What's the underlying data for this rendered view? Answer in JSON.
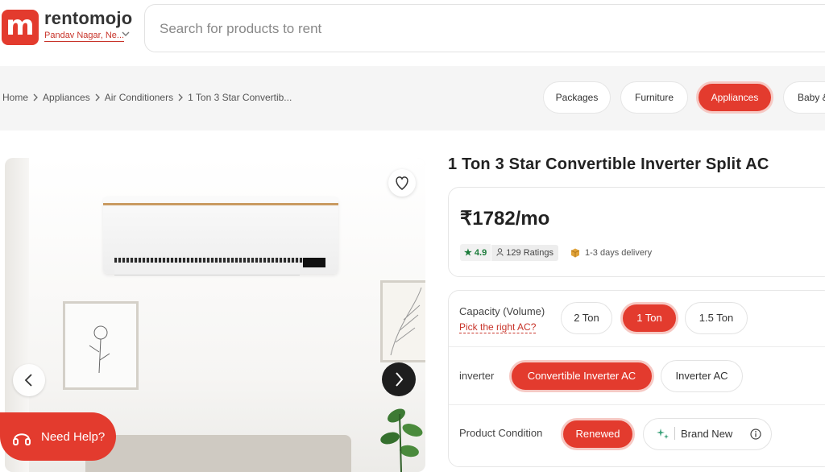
{
  "header": {
    "logo_letter": "m",
    "brand": "rentomojo",
    "location": "Pandav Nagar, Ne...",
    "search_placeholder": "Search for products to rent"
  },
  "breadcrumb": [
    "Home",
    "Appliances",
    "Air Conditioners",
    "1 Ton 3 Star Convertib..."
  ],
  "categories": [
    {
      "label": "Packages",
      "active": false
    },
    {
      "label": "Furniture",
      "active": false
    },
    {
      "label": "Appliances",
      "active": true
    },
    {
      "label": "Baby &",
      "active": false
    }
  ],
  "product": {
    "title": "1 Ton 3 Star Convertible Inverter Split AC",
    "price": "₹1782/mo",
    "rating": "4.9",
    "ratings_count": "129 Ratings",
    "delivery": "1-3 days delivery"
  },
  "options": {
    "capacity_label": "Capacity (Volume)",
    "capacity_help": "Pick the right AC?",
    "capacity": [
      "2 Ton",
      "1 Ton",
      "1.5 Ton"
    ],
    "capacity_selected": "1 Ton",
    "inverter_label": "inverter",
    "inverter": [
      "Convertible Inverter AC",
      "Inverter AC"
    ],
    "inverter_selected": "Convertible Inverter AC",
    "condition_label": "Product Condition",
    "condition": [
      "Renewed",
      "Brand New"
    ],
    "condition_selected": "Renewed"
  },
  "help": {
    "label": "Need Help?"
  },
  "colors": {
    "accent": "#e33b2e",
    "accent_light": "#f6c9c4"
  },
  "icons": [
    "chevron-down-icon",
    "chevron-right-icon",
    "heart-icon",
    "arrow-left-icon",
    "arrow-right-icon",
    "star-icon",
    "user-icon",
    "box-icon",
    "sparkle-icon",
    "info-icon",
    "headset-icon"
  ]
}
